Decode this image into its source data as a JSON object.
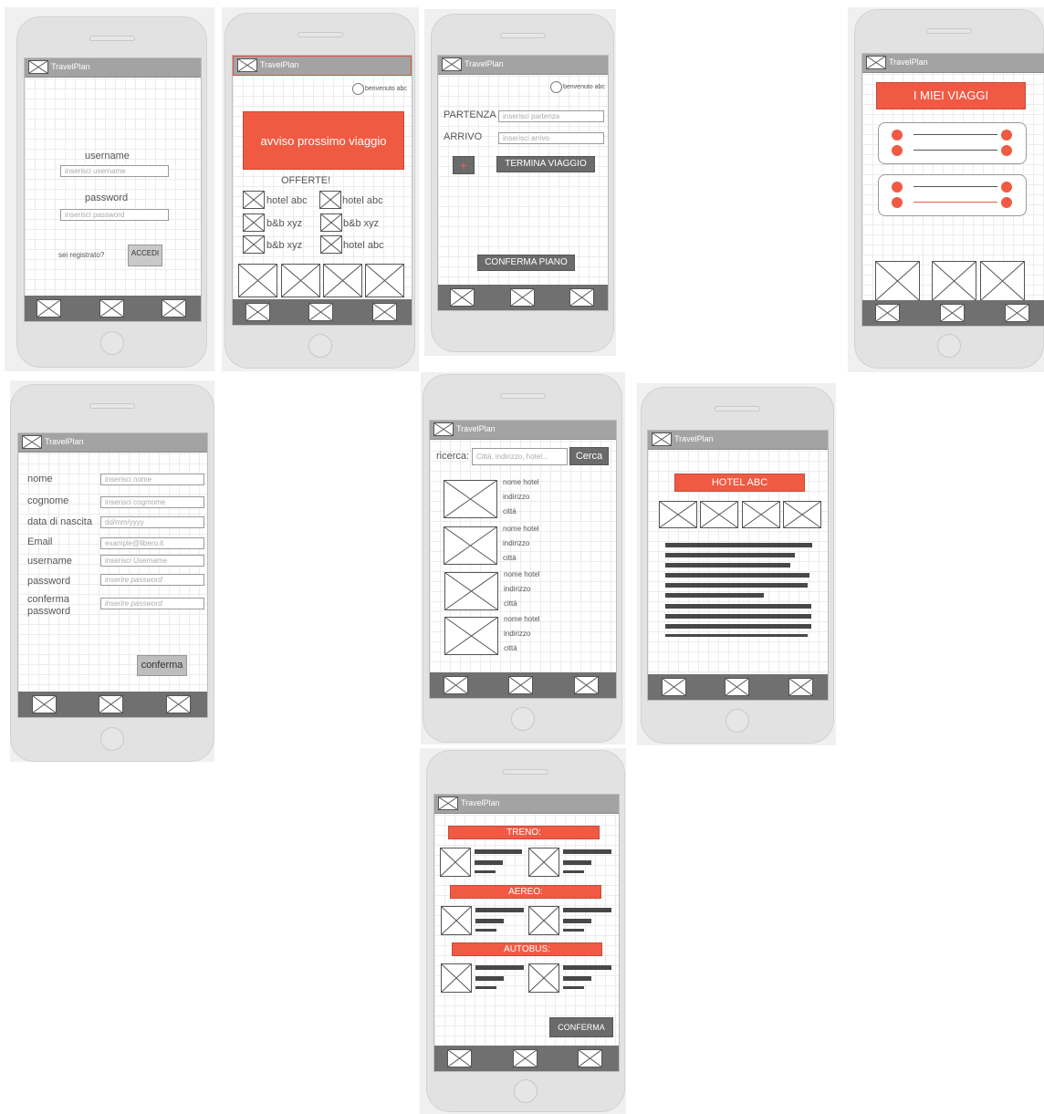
{
  "app_name": "TravelPlan",
  "colors": {
    "accent": "#f05a43",
    "header": "#a3a3a3",
    "footer": "#707070"
  },
  "login": {
    "username_label": "username",
    "username_placeholder": "inserisci username",
    "password_label": "password",
    "password_placeholder": "inserisci password",
    "registered_text": "sei registrato?",
    "login_button": "ACCEDI"
  },
  "home": {
    "welcome": "benvenuto abc",
    "banner": "avviso prossimo viaggio",
    "offers_title": "OFFERTE!",
    "offers": [
      "hotel abc",
      "hotel abc",
      "b&b xyz",
      "b&b xyz",
      "b&b xyz",
      "hotel abc"
    ]
  },
  "plan": {
    "welcome": "benvenuto abc",
    "departure_label": "PARTENZA",
    "departure_placeholder": "inserisci partenza",
    "arrival_label": "ARRIVO",
    "arrival_placeholder": "inserisci arrivo",
    "add_symbol": "+",
    "end_trip_button": "TERMINA VIAGGIO",
    "confirm_plan_button": "CONFERMA PIANO"
  },
  "trips": {
    "title": "I MIEI VIAGGI"
  },
  "register": {
    "fields": [
      {
        "label": "nome",
        "placeholder": "inserisci nome"
      },
      {
        "label": "cognome",
        "placeholder": "inserisci cogmome"
      },
      {
        "label": "data di nascita",
        "placeholder": "dd/mm/yyyy"
      },
      {
        "label": "Email",
        "placeholder": "example@libero.it"
      },
      {
        "label": "username",
        "placeholder": "inserisci Username"
      },
      {
        "label": "password",
        "placeholder": "inserire password"
      },
      {
        "label": "conferma password",
        "placeholder": "inserire password"
      }
    ],
    "confirm_button": "conferma"
  },
  "search": {
    "label": "ricerca:",
    "placeholder": "Città, indirizzo, hotel...",
    "button": "Cerca",
    "result": {
      "name": "nome hotel",
      "address": "indirizzo",
      "city": "città"
    }
  },
  "hotel": {
    "title": "HOTEL ABC"
  },
  "transport": {
    "train": "TRENO:",
    "plane": "AEREO:",
    "bus": "AUTOBUS:",
    "confirm_button": "CONFERMA"
  }
}
